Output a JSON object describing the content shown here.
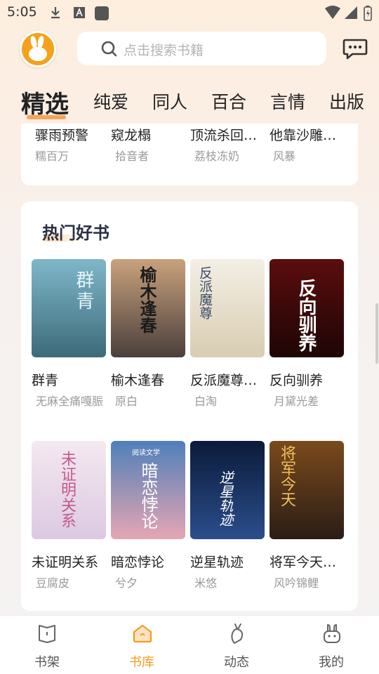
{
  "status_bar": {
    "time": "5:05"
  },
  "search": {
    "placeholder": "点击搜索书籍"
  },
  "tabs": [
    {
      "label": "精选",
      "active": true
    },
    {
      "label": "纯爱"
    },
    {
      "label": "同人"
    },
    {
      "label": "百合"
    },
    {
      "label": "言情"
    },
    {
      "label": "出版"
    }
  ],
  "top_row": [
    {
      "title": "骤雨预警",
      "author": "糯百万"
    },
    {
      "title": "窥龙榻",
      "author": "拾音者"
    },
    {
      "title": "顶流杀回…",
      "author": "荔枝冻奶"
    },
    {
      "title": "他靠沙雕…",
      "author": "风暴"
    }
  ],
  "section": {
    "title": "热门好书"
  },
  "books": [
    {
      "title": "群青",
      "author": "无麻全痛嘎脤",
      "cover_text": "群青",
      "cover_top": "#7fb7c9",
      "cover_bottom": "#3c6b7a"
    },
    {
      "title": "榆木逢春",
      "author": "原白",
      "cover_text": "榆木逢春",
      "cover_top": "#c9a27c",
      "cover_bottom": "#4a3f3c"
    },
    {
      "title": "反派魔尊…",
      "author": "白淘",
      "cover_text": "反派魔尊",
      "cover_top": "#f3efe4",
      "cover_bottom": "#d9cdb2"
    },
    {
      "title": "反向驯养",
      "author": "月黛光差",
      "cover_text": "反向驯养",
      "cover_top": "#5b0d0d",
      "cover_bottom": "#1e0505"
    },
    {
      "title": "未证明关系",
      "author": "豆腐皮",
      "cover_text": "未证明关系",
      "cover_top": "#f4e8f0",
      "cover_bottom": "#dcc9e2"
    },
    {
      "title": "暗恋悖论",
      "author": "兮夕",
      "cover_text": "暗恋悖论",
      "cover_top": "#4f7fb9",
      "cover_bottom": "#e6a6b3"
    },
    {
      "title": "逆星轨迹",
      "author": "米悠",
      "cover_text": "逆星轨迹",
      "cover_top": "#0b1a3a",
      "cover_bottom": "#2b4e8c"
    },
    {
      "title": "将军今天…",
      "author": "风吟锦鲤",
      "cover_text": "将军今天",
      "cover_top": "#7a4a1c",
      "cover_bottom": "#2a1d16"
    }
  ],
  "cover_publisher": "阅读文学",
  "bottom_nav": [
    {
      "label": "书架",
      "icon": "book-icon"
    },
    {
      "label": "书库",
      "icon": "library-icon",
      "active": true
    },
    {
      "label": "动态",
      "icon": "radish-icon"
    },
    {
      "label": "我的",
      "icon": "rabbit-icon"
    }
  ],
  "colors": {
    "accent": "#f39c22",
    "tab_underline": "#f3a65a",
    "logo": "#f6a11b"
  }
}
